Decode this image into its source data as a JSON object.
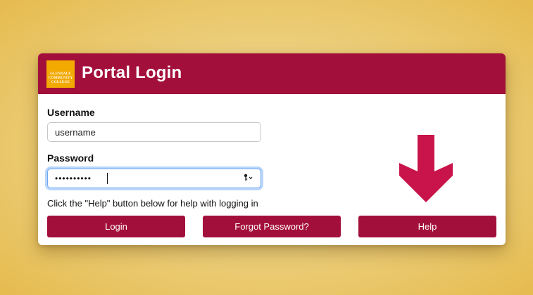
{
  "header": {
    "title": "Portal Login",
    "logo_text": "GLENDALE\nCOMMUNITY\nCOLLEGE"
  },
  "form": {
    "username_label": "Username",
    "username_value": "username",
    "password_label": "Password",
    "password_mask": "••••••••••",
    "key_icon": "key-icon",
    "help_text": "Click the \"Help\" button below for help with logging in"
  },
  "buttons": {
    "login": "Login",
    "forgot": "Forgot Password?",
    "help": "Help"
  },
  "colors": {
    "brand": "#a30f3b",
    "logo": "#f2a900",
    "arrow": "#c8144a"
  }
}
